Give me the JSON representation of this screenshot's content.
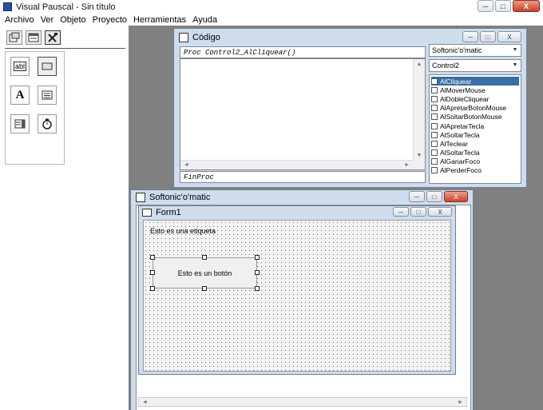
{
  "app": {
    "title": "Visual Pauscal - Sin título"
  },
  "window_controls": {
    "minimize": "─",
    "maximize": "□",
    "close": "X"
  },
  "menu": [
    "Archivo",
    "Ver",
    "Objeto",
    "Proyecto",
    "Herramientas",
    "Ayuda"
  ],
  "palette": {
    "textbox": "abl",
    "label": "A"
  },
  "code_window": {
    "title": "Código",
    "proc_line": "Proc Control2_AlCliquear()",
    "end_line": "FinProc",
    "object_combo": "Softonic'o'matic",
    "control_combo": "Control2",
    "events": [
      "AlCliquear",
      "AlMoverMouse",
      "AlDobleCliquear",
      "AlApretarBotonMouse",
      "AlSoltarBotonMouse",
      "AlApretarTecla",
      "AlSoltarTecla",
      "AlTeclear",
      "AlSoltarTecla",
      "AlGanarFoco",
      "AlPerderFoco"
    ],
    "selected_event": "AlCliquear"
  },
  "softonic_window": {
    "title": "Softonic'o'matic",
    "form_title": "Form1",
    "label_text": "Esto es una etiqueta",
    "button_text": "Esto es un botón"
  },
  "scroll_arrows": {
    "left": "◄",
    "right": "►",
    "up": "▲",
    "down": "▼",
    "combo": "▼"
  },
  "colors": {
    "mdi_background": "#808080",
    "window_frame": "#cfdcec",
    "selection": "#3a6ea5"
  }
}
